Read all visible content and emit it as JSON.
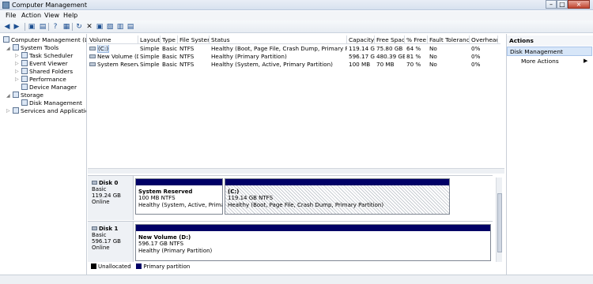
{
  "title_bar": {
    "title": "Computer Management"
  },
  "menu": {
    "items": [
      "File",
      "Action",
      "View",
      "Help"
    ]
  },
  "tree": {
    "root": "Computer Management (Local",
    "system_tools": "System Tools",
    "task_scheduler": "Task Scheduler",
    "event_viewer": "Event Viewer",
    "shared_folders": "Shared Folders",
    "performance": "Performance",
    "device_manager": "Device Manager",
    "storage": "Storage",
    "disk_management": "Disk Management",
    "services": "Services and Applications"
  },
  "volume_list": {
    "columns": [
      "Volume",
      "Layout",
      "Type",
      "File System",
      "Status",
      "Capacity",
      "Free Space",
      "% Free",
      "Fault Tolerance",
      "Overhead"
    ],
    "rows": [
      [
        "(C:)",
        "Simple",
        "Basic",
        "NTFS",
        "Healthy (Boot, Page File, Crash Dump, Primary Partition)",
        "119.14 GB",
        "75.80 GB",
        "64 %",
        "No",
        "0%"
      ],
      [
        "New Volume (D:)",
        "Simple",
        "Basic",
        "NTFS",
        "Healthy (Primary Partition)",
        "596.17 GB",
        "480.39 GB",
        "81 %",
        "No",
        "0%"
      ],
      [
        "System Reserved",
        "Simple",
        "Basic",
        "NTFS",
        "Healthy (System, Active, Primary Partition)",
        "100 MB",
        "70 MB",
        "70 %",
        "No",
        "0%"
      ]
    ]
  },
  "disks": [
    {
      "name": "Disk 0",
      "type": "Basic",
      "size": "119.24 GB",
      "status": "Online",
      "partitions": [
        {
          "name": "System Reserved",
          "size_fs": "100 MB NTFS",
          "status": "Healthy (System, Active, Primary P"
        },
        {
          "name": "(C:)",
          "size_fs": "119.14 GB NTFS",
          "status": "Healthy (Boot, Page File, Crash Dump, Primary Partition)"
        }
      ]
    },
    {
      "name": "Disk 1",
      "type": "Basic",
      "size": "596.17 GB",
      "status": "Online",
      "partitions": [
        {
          "name": "New Volume  (D:)",
          "size_fs": "596.17 GB NTFS",
          "status": "Healthy (Primary Partition)"
        }
      ]
    }
  ],
  "legend": {
    "unallocated": "Unallocated",
    "primary": "Primary partition"
  },
  "actions": {
    "header": "Actions",
    "section": "Disk Management",
    "more": "More Actions"
  },
  "colors": {
    "primary_partition": "#000066",
    "selected_row": "#d8e6f8"
  }
}
